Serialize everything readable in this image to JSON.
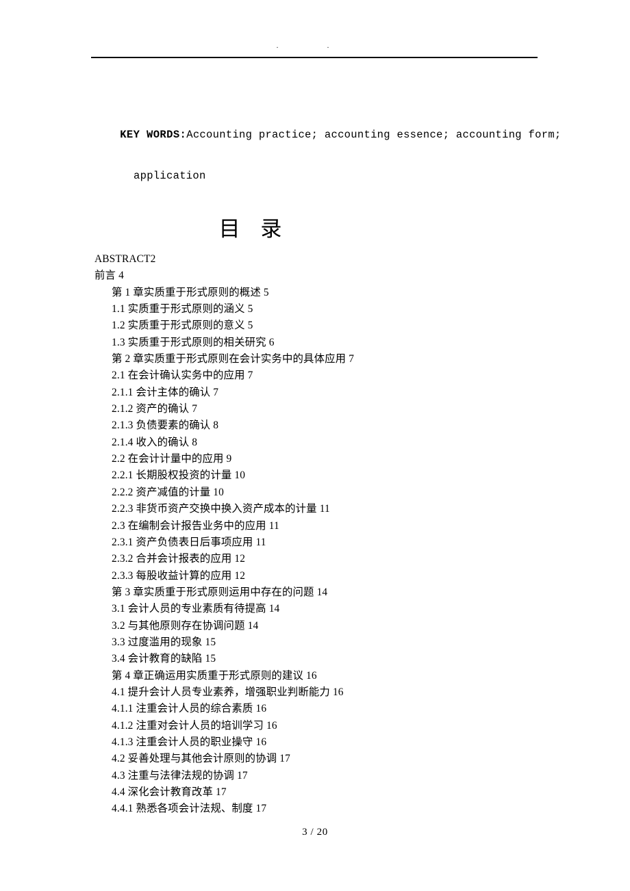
{
  "page": {
    "header_marks": ". .",
    "footer_text": "3 / 20"
  },
  "keywords": {
    "label": "KEY WORDS:",
    "body": "Accounting practice; accounting essence; accounting form;",
    "continuation": "application"
  },
  "toc": {
    "title": "目 录",
    "entries": [
      {
        "text": "ABSTRACT2",
        "level": 0
      },
      {
        "text": "前言 4",
        "level": 0
      },
      {
        "text": "第 1 章实质重于形式原则的概述 5",
        "level": 1
      },
      {
        "text": "1.1 实质重于形式原则的涵义 5",
        "level": 1
      },
      {
        "text": "1.2 实质重于形式原则的意义 5",
        "level": 1
      },
      {
        "text": "1.3 实质重于形式原则的相关研究 6",
        "level": 1
      },
      {
        "text": "第 2 章实质重于形式原则在会计实务中的具体应用 7",
        "level": 1
      },
      {
        "text": "2.1 在会计确认实务中的应用 7",
        "level": 1
      },
      {
        "text": "2.1.1 会计主体的确认 7",
        "level": 1
      },
      {
        "text": "2.1.2 资产的确认 7",
        "level": 1
      },
      {
        "text": "2.1.3 负债要素的确认 8",
        "level": 1
      },
      {
        "text": "2.1.4 收入的确认 8",
        "level": 1
      },
      {
        "text": "2.2 在会计计量中的应用 9",
        "level": 1
      },
      {
        "text": "2.2.1 长期股权投资的计量 10",
        "level": 1
      },
      {
        "text": "2.2.2 资产减值的计量 10",
        "level": 1
      },
      {
        "text": "2.2.3 非货币资产交换中换入资产成本的计量 11",
        "level": 1
      },
      {
        "text": "2.3 在编制会计报告业务中的应用 11",
        "level": 1
      },
      {
        "text": "2.3.1 资产负债表日后事项应用 11",
        "level": 1
      },
      {
        "text": "2.3.2 合并会计报表的应用 12",
        "level": 1
      },
      {
        "text": "2.3.3 每股收益计算的应用 12",
        "level": 1
      },
      {
        "text": "第 3 章实质重于形式原则运用中存在的问题 14",
        "level": 1
      },
      {
        "text": "3.1 会计人员的专业素质有待提高 14",
        "level": 1
      },
      {
        "text": "3.2 与其他原则存在协调问题 14",
        "level": 1
      },
      {
        "text": "3.3 过度滥用的现象 15",
        "level": 1
      },
      {
        "text": "3.4 会计教育的缺陷 15",
        "level": 1
      },
      {
        "text": "第 4 章正确运用实质重于形式原则的建议 16",
        "level": 1
      },
      {
        "text": "4.1 提升会计人员专业素养，增强职业判断能力 16",
        "level": 1
      },
      {
        "text": "4.1.1 注重会计人员的综合素质 16",
        "level": 1
      },
      {
        "text": "4.1.2 注重对会计人员的培训学习 16",
        "level": 1
      },
      {
        "text": "4.1.3 注重会计人员的职业操守 16",
        "level": 1
      },
      {
        "text": "4.2 妥善处理与其他会计原则的协调 17",
        "level": 1
      },
      {
        "text": "4.3 注重与法律法规的协调 17",
        "level": 1
      },
      {
        "text": "4.4 深化会计教育改革 17",
        "level": 1
      },
      {
        "text": "4.4.1 熟悉各项会计法规、制度 17",
        "level": 1
      }
    ]
  }
}
